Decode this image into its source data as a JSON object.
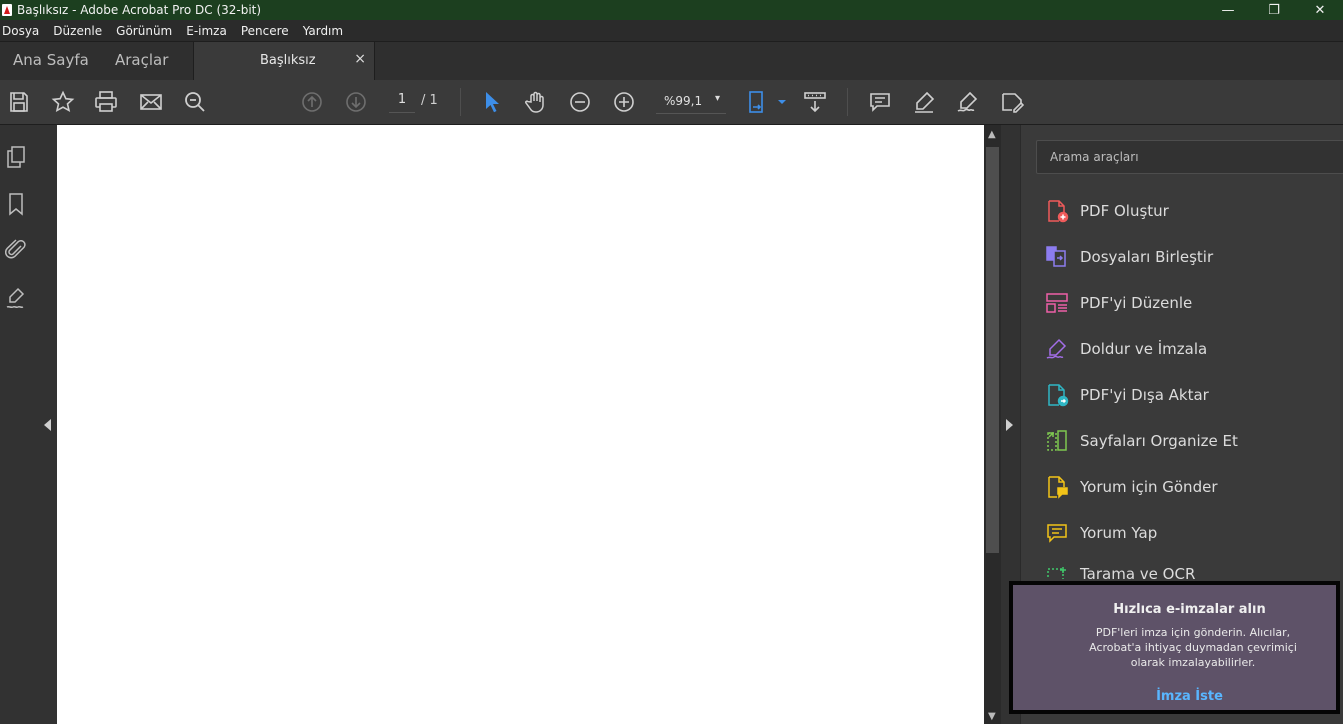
{
  "window": {
    "title": "Başlıksız - Adobe Acrobat Pro DC (32-bit)",
    "controls": {
      "minimize": "—",
      "restore": "❐",
      "close": "✕"
    }
  },
  "menu": [
    "Dosya",
    "Düzenle",
    "Görünüm",
    "E-imza",
    "Pencere",
    "Yardım"
  ],
  "tabs": {
    "home": "Ana Sayfa",
    "tools": "Araçlar",
    "document": "Başlıksız",
    "close": "×"
  },
  "toolbar": {
    "page_current": "1",
    "page_total": "/ 1",
    "zoom": "%99,1",
    "zoom_caret": "▾"
  },
  "scrollbar": {
    "up": "▲",
    "down": "▼"
  },
  "right_panel": {
    "search_placeholder": "Arama araçları",
    "tools": [
      {
        "label": "PDF Oluştur",
        "icon": "create-pdf-icon",
        "color": "#ef5b5b"
      },
      {
        "label": "Dosyaları Birleştir",
        "icon": "combine-files-icon",
        "color": "#8c7cf0"
      },
      {
        "label": "PDF'yi Düzenle",
        "icon": "edit-pdf-icon",
        "color": "#ee5fa7"
      },
      {
        "label": "Doldur ve İmzala",
        "icon": "fill-sign-icon",
        "color": "#a36ee8"
      },
      {
        "label": "PDF'yi Dışa Aktar",
        "icon": "export-pdf-icon",
        "color": "#2fb6c4"
      },
      {
        "label": "Sayfaları Organize Et",
        "icon": "organize-pages-icon",
        "color": "#7ec850"
      },
      {
        "label": "Yorum için Gönder",
        "icon": "send-for-comments-icon",
        "color": "#f2c318"
      },
      {
        "label": "Yorum Yap",
        "icon": "comment-icon",
        "color": "#f2c318"
      },
      {
        "label": "Tarama ve OCR",
        "icon": "scan-ocr-icon",
        "color": "#3fc76a"
      }
    ]
  },
  "promo": {
    "title": "Hızlıca e-imzalar alın",
    "body": "PDF'leri imza için gönderin. Alıcılar, Acrobat'a ihtiyaç duymadan çevrimiçi olarak imzalayabilirler.",
    "link": "İmza İste"
  },
  "colors": {
    "accent_blue": "#3d8ee8",
    "titlebar": "#1c3f1f",
    "promo_bg": "#5e5268"
  }
}
